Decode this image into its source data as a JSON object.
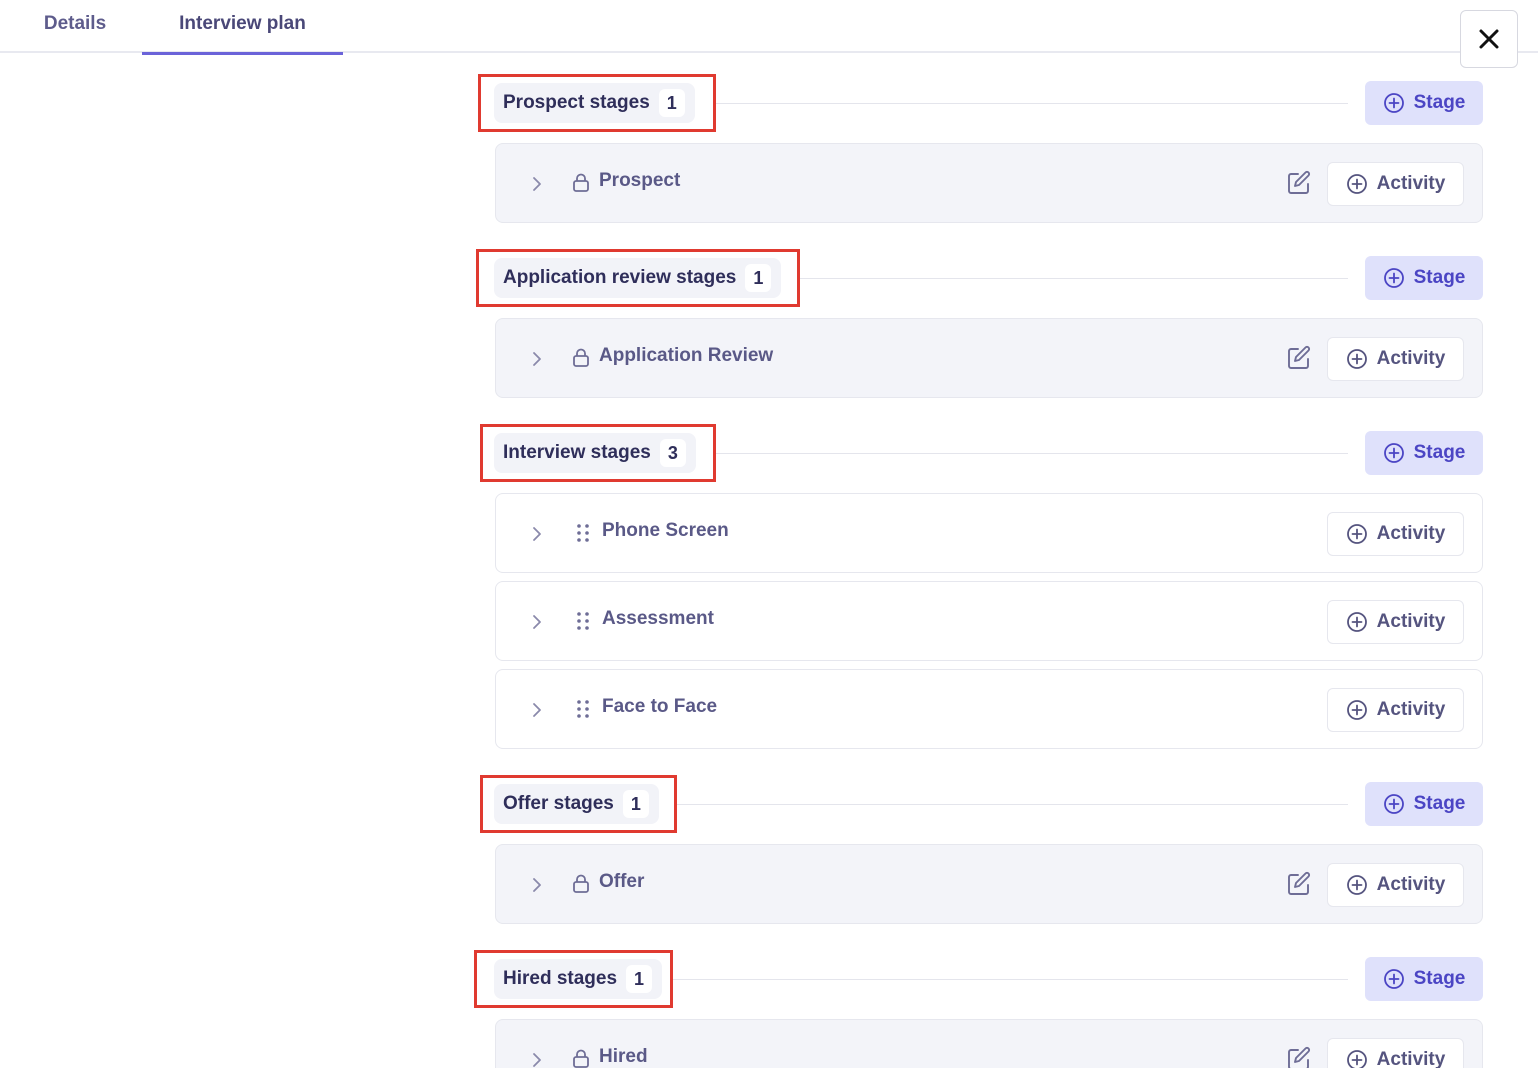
{
  "tabs": {
    "details": "Details",
    "interview_plan": "Interview plan"
  },
  "buttons": {
    "stage": "Stage",
    "activity": "Activity"
  },
  "colors": {
    "accent": "#6b63d9",
    "stage_button_bg": "#dfe1fb",
    "highlight": "#e03a30"
  },
  "sections": [
    {
      "title": "Prospect stages",
      "count": "1",
      "stages": [
        {
          "name": "Prospect",
          "locked": true
        }
      ]
    },
    {
      "title": "Application review stages",
      "count": "1",
      "stages": [
        {
          "name": "Application Review",
          "locked": true
        }
      ]
    },
    {
      "title": "Interview stages",
      "count": "3",
      "stages": [
        {
          "name": "Phone Screen",
          "locked": false
        },
        {
          "name": "Assessment",
          "locked": false
        },
        {
          "name": "Face to Face",
          "locked": false
        }
      ]
    },
    {
      "title": "Offer stages",
      "count": "1",
      "stages": [
        {
          "name": "Offer",
          "locked": true
        }
      ]
    },
    {
      "title": "Hired stages",
      "count": "1",
      "stages": [
        {
          "name": "Hired",
          "locked": true
        }
      ]
    }
  ]
}
